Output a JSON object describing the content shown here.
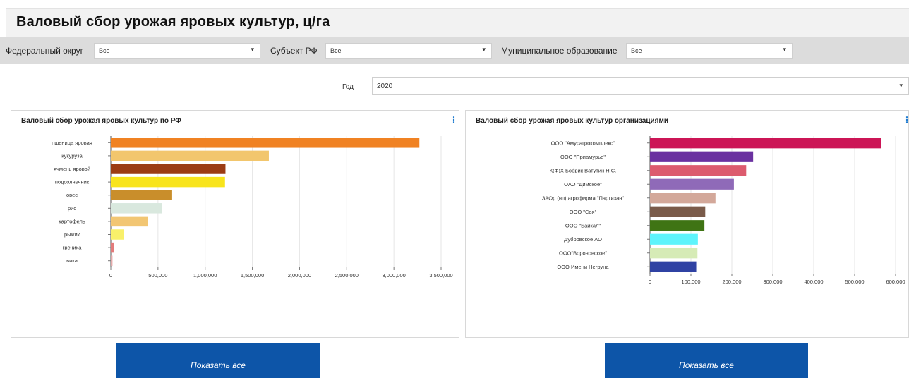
{
  "header": {
    "title": "Валовый сбор урожая яровых культур, ц/га"
  },
  "filters": {
    "federal_district": {
      "label": "Федеральный округ",
      "value": "Все"
    },
    "subject": {
      "label": "Субъект РФ",
      "value": "Все"
    },
    "municipality": {
      "label": "Муниципальное образование",
      "value": "Все"
    },
    "year": {
      "label": "Год",
      "value": "2020"
    }
  },
  "colors": {
    "accent": "#0d55a8",
    "kebab": "#1e7bd0"
  },
  "icons": {
    "dropdown": "caret-down-icon",
    "menu": "kebab-menu-icon"
  },
  "left_panel": {
    "title": "Валовый сбор урожая яровых культур по РФ",
    "menu_glyph": "⋮",
    "button_label": "Показать все"
  },
  "right_panel": {
    "title": "Валовый сбор урожая яровых культур организациями",
    "menu_glyph": "⋮",
    "button_label": "Показать все"
  },
  "chart_data": [
    {
      "type": "bar",
      "orientation": "horizontal",
      "categories": [
        "пшеница яровая",
        "кукуруза",
        "ячмень яровой",
        "подсолнечник",
        "овес",
        "рис",
        "картофель",
        "рыжик",
        "гречиха",
        "вика"
      ],
      "values": [
        3270000,
        1675000,
        1215000,
        1210000,
        650000,
        545000,
        395000,
        135000,
        35000,
        18000
      ],
      "colors": [
        "#f08223",
        "#f2c66d",
        "#9c3c14",
        "#f8e41c",
        "#c98e2b",
        "#d9e8de",
        "#f2c673",
        "#f9f06a",
        "#e37b7b",
        "#e3a9a9"
      ],
      "xlim": [
        0,
        3500000
      ],
      "xticks": [
        0,
        500000,
        1000000,
        1500000,
        2000000,
        2500000,
        3000000,
        3500000
      ],
      "xtick_labels": [
        "0",
        "500,000",
        "1,000,000",
        "1,500,000",
        "2,000,000",
        "2,500,000",
        "3,000,000",
        "3,500,000"
      ],
      "grid": true
    },
    {
      "type": "bar",
      "orientation": "horizontal",
      "categories": [
        "ООО \"Амурагрокомплекс\"",
        "ООО \"Приамурье\"",
        "К(Ф)Х Бобрик Ватутин Н.С.",
        "ОАО \"Димское\"",
        "ЗАОр (нп) агрофирма \"Партизан\"",
        "ООО \"Соя\"",
        "ООО \"Байкал\"",
        "Дубровское АО",
        "ООО\"Вороновское\"",
        "ООО Имени Негруна"
      ],
      "values": [
        565000,
        252000,
        235000,
        205000,
        160000,
        135000,
        133000,
        117000,
        116000,
        113000
      ],
      "colors": [
        "#cc1556",
        "#6a31a0",
        "#dc5b6e",
        "#8f6ab8",
        "#d3a89a",
        "#7a5b4a",
        "#3f7414",
        "#5ef4fb",
        "#d6ebb6",
        "#2f42a3"
      ],
      "xlim": [
        0,
        600000
      ],
      "xticks": [
        0,
        100000,
        200000,
        300000,
        400000,
        500000,
        600000
      ],
      "xtick_labels": [
        "0",
        "100,000",
        "200,000",
        "300,000",
        "400,000",
        "500,000",
        "600,000"
      ],
      "grid": true
    }
  ]
}
